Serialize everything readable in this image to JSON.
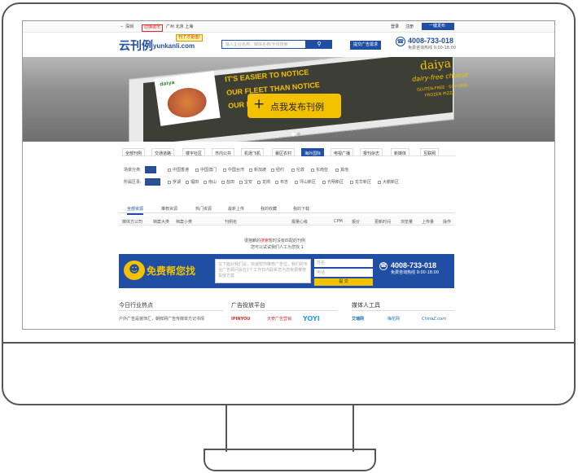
{
  "topbar": {
    "location": "深圳",
    "switch_city": "切换城市",
    "cities": "广州 北京 上海",
    "login": "登录",
    "register": "注册",
    "publish": "一键发布"
  },
  "header": {
    "logo_cn": "云刊例",
    "logo_en": "yunkanli.com",
    "badge": "刊了才更值!",
    "search_placeholder": "输入企业名称、媒体名称/字母搜索",
    "submit_btn": "提交广告需求",
    "hotline": "4008-733-018",
    "hotline_sub": "免费咨询热线 9:00-18:00"
  },
  "hero": {
    "cta": "点我发布刊例",
    "ad_line1": "IT'S EASIER TO NOTICE",
    "ad_line2": "OUR FLEET THAN NOTICE",
    "ad_line3": "OUR PIZZA IS DAIRY-FREE.",
    "brand": "daiya",
    "brand_sub": "dairy-free cheese",
    "flags": "GLUTEN-FREE · SOY-FREE",
    "product": "FROZEN PIZZA"
  },
  "categories": {
    "tabs": [
      "全部刊例",
      "交通道路",
      "楼宇社区",
      "市内公共",
      "机场飞机",
      "暴区农村",
      "海外国际",
      "电视广播",
      "报刊杂志",
      "新媒体",
      "互联网"
    ]
  },
  "filters": {
    "media_label": "场景分类:",
    "media_items": [
      "不限",
      "中国香港",
      "中国澳门",
      "中国台湾",
      "新加坡",
      "纽约",
      "伦敦",
      "东南亚",
      "其他"
    ],
    "region_label": "所属区县:",
    "region_items": [
      "全深圳",
      "罗湖",
      "福田",
      "南山",
      "盐田",
      "宝安",
      "龙岗",
      "布吉",
      "坪山新区",
      "光明新区",
      "龙华新区",
      "大鹏新区"
    ]
  },
  "results": {
    "tabs": [
      "全部资源",
      "推荐资源",
      "热门资源",
      "最新上传",
      "我的收藏",
      "我的下载"
    ],
    "columns": [
      "媒体方公司",
      "档案大类",
      "档案小类",
      "刊例名",
      "报量心级",
      "CPM",
      "报价",
      "更新时间",
      "浏览量",
      "上传量",
      "操作"
    ],
    "empty_line1": "很抱歉的",
    "empty_highlight": "搜索",
    "empty_line1b": "暂时没有匹配的刊例",
    "empty_line2": "您可以试试我们人工为您找 1"
  },
  "help_banner": {
    "title": "免费帮您找",
    "textarea_placeholder": "在下面对我们说，快速帮你推荐广告位，我们的专业广告顾问会在1个工作日内联系您为您免费推荐投放方案",
    "name_placeholder": "姓名",
    "phone_placeholder": "电话",
    "submit": "提 交",
    "hotline": "4008-733-018",
    "hotline_sub": "免费咨询热线 9:00-18:00"
  },
  "footer": {
    "news_title": "今日行业热点",
    "news_item": "户外广告是装饰汇，朝鲜网广告传媒单方记书情",
    "platform_title": "广告投放平台",
    "platform_logos": [
      "IPINYOU",
      "天奇广告营销",
      "YOYI"
    ],
    "media_title": "媒体人工具",
    "media_logos": [
      "艾瑞网",
      "梅花网",
      "ChinaZ.com"
    ]
  },
  "colors": {
    "brand_blue": "#1f4ea3",
    "cta_yellow": "#f2c200",
    "accent_red": "#e02b2b"
  }
}
